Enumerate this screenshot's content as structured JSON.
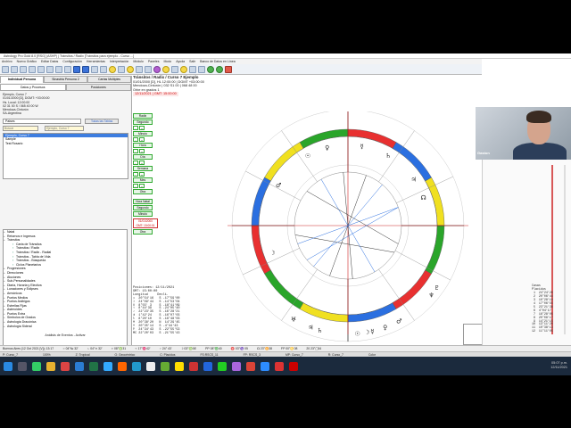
{
  "window": {
    "title": "Astrology Pro Gold 8.0 [RSG] (ASHP) | Tránsitos / Radix [Tránsitos para ejemplo - Curso ...]"
  },
  "menu": [
    "Archivo",
    "Nuevo Gráfico",
    "Editar Datos",
    "Configuración",
    "Herramientas",
    "Interpretación",
    "Módulo",
    "Paneles",
    "Modo",
    "Ayuda",
    "Salir",
    "Banco de Datos en Línea"
  ],
  "left": {
    "tab_active": "Individual Persona",
    "tab_other": "Sinastria Persona 2",
    "tab_third": "Cartas Múltiples",
    "subtab_active": "Datos y Procesos",
    "subtab_other": "Posiciones",
    "person_lines": [
      "Ejemplo, Curso 7",
      "01/01/2000 [D], DGMT: +03:00:00",
      "Hs. Local: 12:00:00",
      "02 31 00 S / 065 40 00 W",
      "Mendoza-Cinturón",
      "SA-Argentina"
    ],
    "combo_value": "Paises",
    "combo_btn": "Todas las Tablas",
    "search_placeholder": "Buscar",
    "search_field2": "Ejemplo, Curso 7",
    "list": [
      "Ejemplo, Curso 7",
      "Sample",
      "Test Rosario"
    ],
    "tree": [
      {
        "label": "Natal",
        "type": "node",
        "lvl": 1
      },
      {
        "label": "Retornos e Ingresos",
        "type": "node",
        "lvl": 1
      },
      {
        "label": "Tránsitos",
        "type": "node",
        "lvl": 1
      },
      {
        "label": "Carta de Tránsitos",
        "type": "leaf",
        "lvl": 2
      },
      {
        "label": "Tránsitos / Radix",
        "type": "leaf",
        "lvl": 2
      },
      {
        "label": "Tránsitos / Radix - Radial",
        "type": "leaf",
        "lvl": 2
      },
      {
        "label": "Tránsitos - Tabla de Vida",
        "type": "leaf",
        "lvl": 2
      },
      {
        "label": "Tránsitos - Búsqueda",
        "type": "leaf",
        "lvl": 2
      },
      {
        "label": "Ciclos Planetarios",
        "type": "leaf",
        "lvl": 2
      },
      {
        "label": "Progresiones",
        "type": "node",
        "lvl": 1
      },
      {
        "label": "Direcciones",
        "type": "node",
        "lvl": 1
      },
      {
        "label": "Aluciones",
        "type": "node",
        "lvl": 1
      },
      {
        "label": "Sub-Personalidades",
        "type": "node",
        "lvl": 1
      },
      {
        "label": "Diaria, Horaria y Electiva",
        "type": "node",
        "lvl": 1
      },
      {
        "label": "Lunaciones y Eclipses",
        "type": "node",
        "lvl": 1
      },
      {
        "label": "Armónicos",
        "type": "node",
        "lvl": 1
      },
      {
        "label": "Puntos Medios",
        "type": "node",
        "lvl": 1
      },
      {
        "label": "Puntos Arábigos",
        "type": "node",
        "lvl": 1
      },
      {
        "label": "Estrellas Fijas",
        "type": "node",
        "lvl": 1
      },
      {
        "label": "Asteroides",
        "type": "node",
        "lvl": 1
      },
      {
        "label": "Puntos Extra",
        "type": "node",
        "lvl": 1
      },
      {
        "label": "Símbolos de Grados",
        "type": "node",
        "lvl": 1
      },
      {
        "label": "Astrología Dracónica",
        "type": "node",
        "lvl": 1
      },
      {
        "label": "Astrología Sideral",
        "type": "node",
        "lvl": 1
      }
    ],
    "analisis": "Análisis de Eventos - Activar"
  },
  "controls": {
    "radix_label": "Radix",
    "seg_label": "Segundo",
    "min_label": "Minuto",
    "hora_label": "Hora",
    "dia_label": "Día",
    "sem_label": "Semana",
    "mes_label": "Mes",
    "otra_label": "Otra",
    "hora_natal": "Hora Natal",
    "seg2": "Segundo",
    "minuto2": "Minuto",
    "date1": "01/01/2000",
    "date2": "GMT: 15:00:01",
    "otra2": "Otra"
  },
  "chart_header": {
    "title": "Tránsitos / Radix / Curso 7 Ejemplo",
    "line1": "01/01/2000 [D], HL 12:00:00 | DGMT +03:00:00",
    "line2": "Mendoza-Cinturón | 032 S1 00 | 068 48 00",
    "orbe": "Orbe en grados 1",
    "date_red": "12/11/2021 | GMT: 15:00:00"
  },
  "transit_block": "Posiciones: 12/11/2021\nGMT: 15:00:00\nLongitud     Decli.\n☉  20°54'16   S -17°59'00\n☽  24°09'44   S -14°53'04\n☿  8°55' 3    S -18°41'09\n♀  8°44'39    S -24°05'40\n♂  22°23'35   S -16°28'21\n♃  1°42'24    S -16°07'03\n♄  8°20'10    S -16°48'03\n♅  20°38'20   N  14°29'45\n♆  20°35'14   S -4°44'43\n♇  24°34'43   S -22°55'53\nMC 22°20'03   S -21°55'43",
  "casas_block": "Casas\nPlacidus\n 1  24°24'26\n 2  20°06'44\n 3  10°28'10\n 4  17°06'55\n 5  23°21'38\n 6  4°04'17\n 7  18°28'05\n 8  20°08'17\n 9  14°21'15\n10  13°11'20\n11  10°38'13\n12  11°11'05",
  "status": [
    "Buenos Aires (12 Oct 2021 [V]); 13:17",
    "♃ 04°№ 32'",
    "♄ 04°≏ 32'",
    "♅ 08°♍31",
    "♆ 17°♓42'",
    "♇ 24° 43'",
    "☽ 03°♍06'",
    "PP 08°♎40",
    "♈ 03°♑ 05",
    "☊ 23°♊38",
    "FP 00°♋08",
    "20 23°▢34"
  ],
  "status2": [
    "P: Curso_7",
    "100%",
    "Z: Tropical",
    "G: Geocéntrico",
    "C: Placidus",
    "FS:RSCS_11",
    "FP: RSCS_3",
    "MP: Curso_7",
    "R: Curso_7",
    "Color"
  ],
  "taskbar": {
    "time": "05:07 p.m.",
    "date": "12/11/2021"
  },
  "webcam_label": "Gaston",
  "colors": {
    "fire": "#e83030",
    "earth": "#2aa52a",
    "air": "#f0e020",
    "water": "#2b6fe0"
  }
}
